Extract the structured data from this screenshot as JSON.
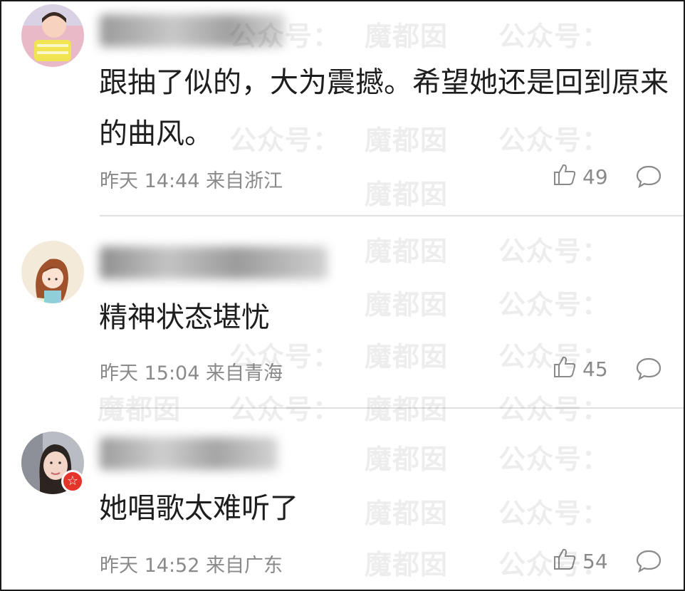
{
  "comments": [
    {
      "text": "跟抽了似的，大为震撼。希望她还是回到原来的曲风。",
      "time": "昨天 14:44",
      "location": "来自浙江",
      "likes": "49"
    },
    {
      "text": "精神状态堪忧",
      "time": "昨天 15:04",
      "location": "来自青海",
      "likes": "45"
    },
    {
      "text": "她唱歌太难听了",
      "time": "昨天 14:52",
      "location": "来自广东",
      "likes": "54"
    }
  ],
  "watermark": {
    "text_public": "公众号：",
    "text_name": "魔都囡"
  },
  "icons": {
    "like": "thumbs-up-icon",
    "reply": "comment-bubble-icon",
    "badge": "verified-star-icon"
  },
  "colors": {
    "text": "#1e1e1e",
    "meta": "#8a8a8a",
    "divider": "#e0e0e0",
    "badge": "#e5352b"
  }
}
